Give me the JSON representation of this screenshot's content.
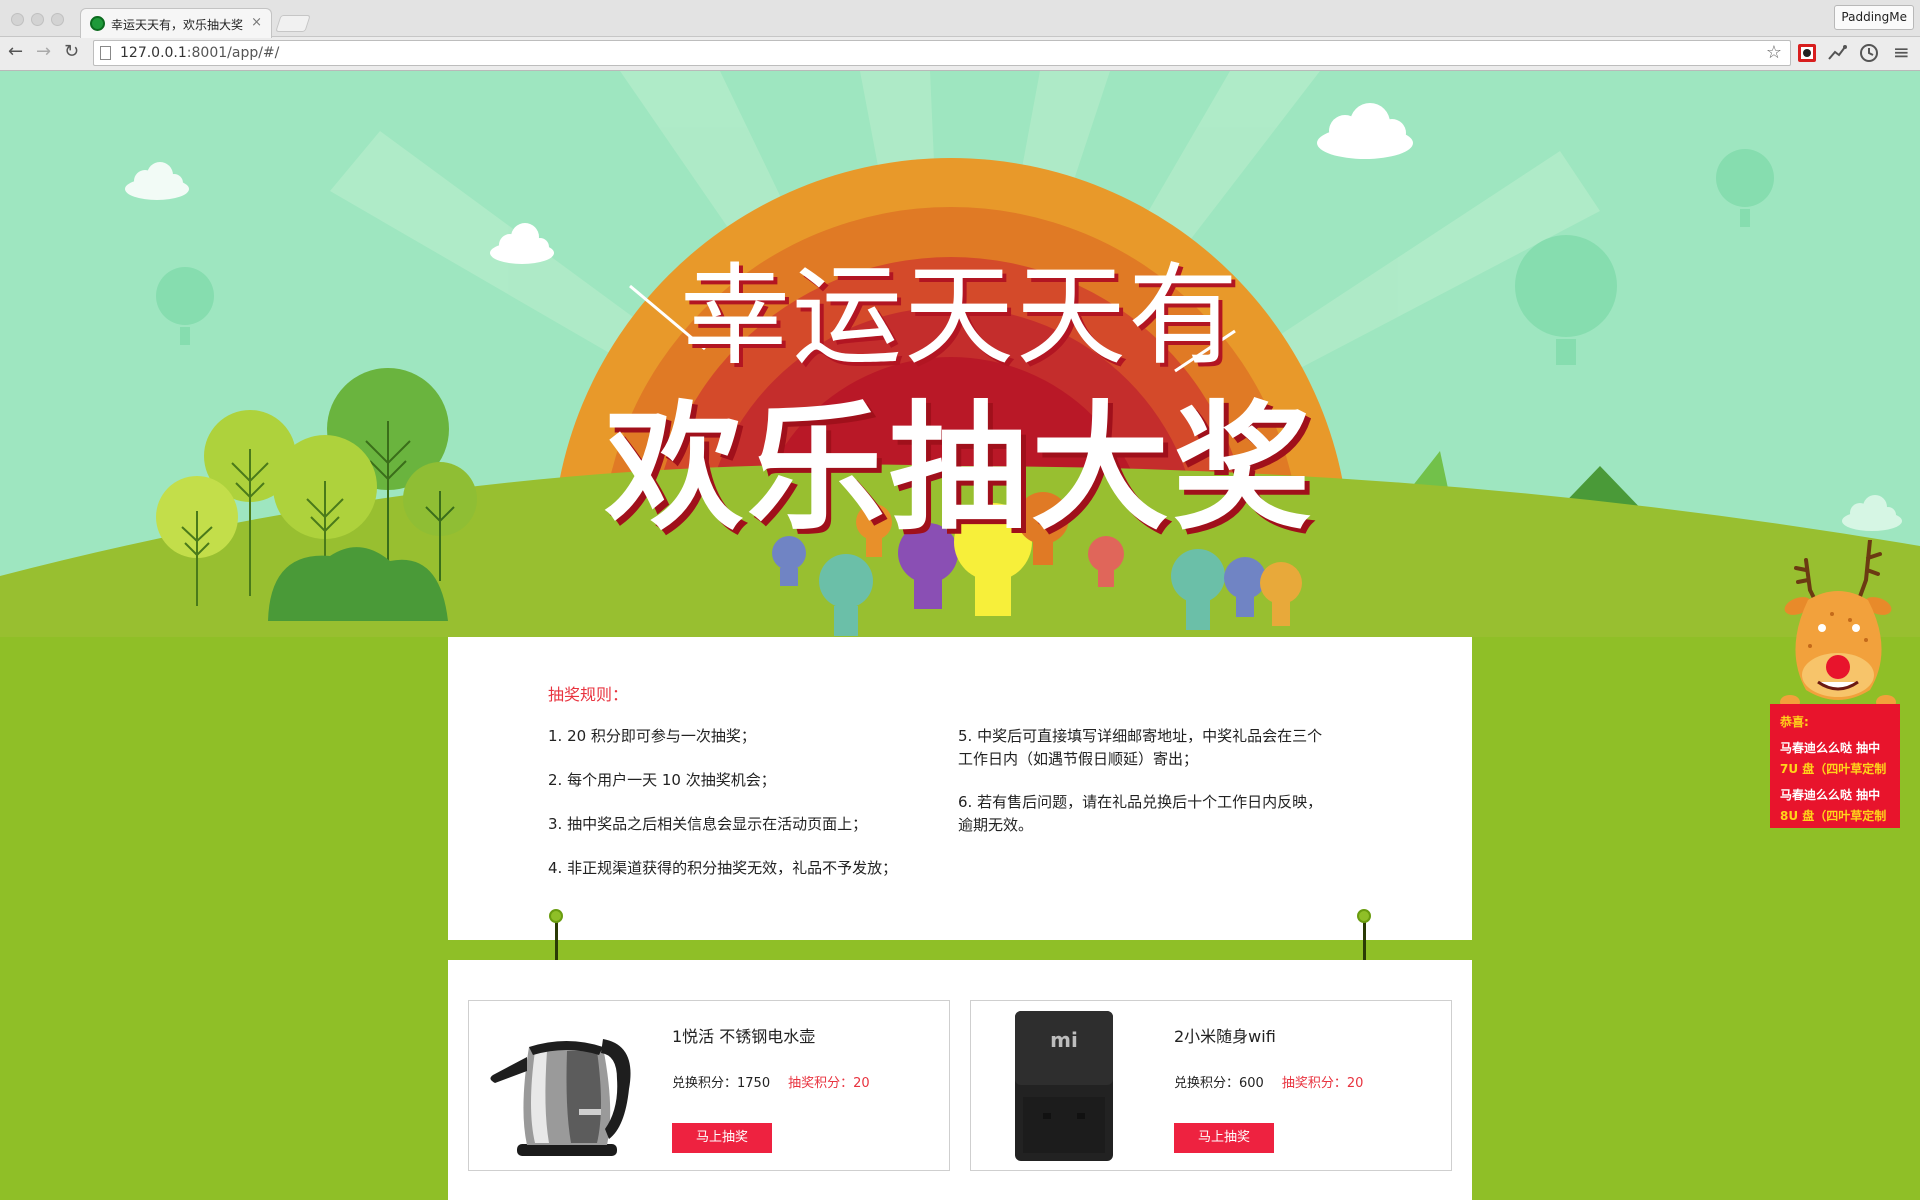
{
  "browser": {
    "tab_title": "幸运天天有，欢乐抽大奖",
    "tab_close": "×",
    "profile_button": "PaddingMe",
    "url_host": "127.0.0.1",
    "url_rest": ":8001/app/#/",
    "nav": {
      "back": "←",
      "forward": "→",
      "reload": "↻",
      "bookmark": "☆",
      "menu": "≡"
    }
  },
  "hero": {
    "title_line1": "幸运天天有",
    "title_line2": "欢乐抽大奖"
  },
  "rules": {
    "heading": "抽奖规则：",
    "left": [
      "1. 20 积分即可参与一次抽奖；",
      "2. 每个用户一天 10 次抽奖机会；",
      "3. 抽中奖品之后相关信息会显示在活动页面上；",
      "4. 非正规渠道获得的积分抽奖无效，礼品不予发放；"
    ],
    "right": [
      "5. 中奖后可直接填写详细邮寄地址，中奖礼品会在三个工作日内（如遇节假日顺延）寄出；",
      "6. 若有售后问题，请在礼品兑换后十个工作日内反映，逾期无效。"
    ]
  },
  "products": [
    {
      "name": "1悦活 不锈钢电水壶",
      "exchange_label": "兑换积分：",
      "exchange_points": "1750",
      "lottery_label": "抽奖积分：",
      "lottery_points": "20",
      "button": "马上抽奖",
      "image": "kettle"
    },
    {
      "name": "2小米随身wifi",
      "exchange_label": "兑换积分：",
      "exchange_points": "600",
      "lottery_label": "抽奖积分：",
      "lottery_points": "20",
      "button": "马上抽奖",
      "image": "mi-wifi"
    }
  ],
  "winners": {
    "title": "恭喜:",
    "entries": [
      {
        "user": "马春迪么么哒 抽中",
        "prize": "7U 盘（四叶草定制"
      },
      {
        "user": "马春迪么么哒 抽中",
        "prize": "8U 盘（四叶草定制"
      }
    ]
  },
  "colors": {
    "accent_red": "#ee2240",
    "grass_green": "#8fbf27",
    "sky": "#9ee6c0",
    "winners_banner": "#e8142c",
    "prize_yellow": "#ffd41a"
  }
}
